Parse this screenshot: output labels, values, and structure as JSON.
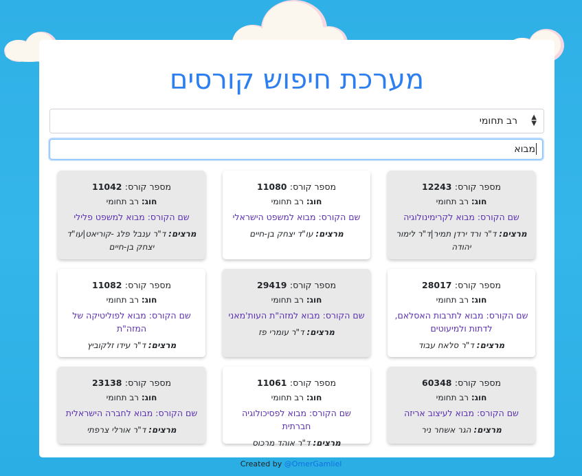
{
  "header": {
    "title": "מערכת חיפוש קורסים"
  },
  "filter": {
    "selected": "רב תחומי"
  },
  "search": {
    "value": "מבוא"
  },
  "labels": {
    "course_number": "מספר קורס:",
    "department": "חוג:",
    "course_name": "שם הקורס:",
    "lecturers": "מרצים:"
  },
  "courses": [
    {
      "number": "12243",
      "department": "רב תחומי",
      "name": "מבוא לקרימינולוגיה",
      "lecturers": "ד\"ר ורד ירדן תמיר|ד\"ר לימור יהודה"
    },
    {
      "number": "11080",
      "department": "רב תחומי",
      "name": "מבוא למשפט הישראלי",
      "lecturers": "עו\"ד יצחק בן-חיים"
    },
    {
      "number": "11042",
      "department": "רב תחומי",
      "name": "מבוא למשפט פלילי",
      "lecturers": "ד\"ר ענבל פלג -קוריאט|עו\"ד יצחק בן-חיים"
    },
    {
      "number": "28017",
      "department": "רב תחומי",
      "name": "מבוא לתרבות האסלאם, לדתות ולמיעוטים",
      "lecturers": "ד\"ר סלאח עבוד"
    },
    {
      "number": "29419",
      "department": "רב תחומי",
      "name": "מבוא למזה\"ת העות'מאני",
      "lecturers": "ד\"ר עומרי פז"
    },
    {
      "number": "11082",
      "department": "רב תחומי",
      "name": "מבוא לפוליטיקה של המזה\"ת",
      "lecturers": "ד\"ר עידו זלקוביץ"
    },
    {
      "number": "60348",
      "department": "רב תחומי",
      "name": "מבוא לעיצוב אריזה",
      "lecturers": "הגר אשחר ניר"
    },
    {
      "number": "11061",
      "department": "רב תחומי",
      "name": "מבוא לפסיכולוגיה חברתית",
      "lecturers": "ד\"ר אוהד מרכוס"
    },
    {
      "number": "23138",
      "department": "רב תחומי",
      "name": "מבוא לחברה הישראלית",
      "lecturers": "ד\"ר אורלי צרפתי"
    }
  ],
  "footer": {
    "text": "Created by",
    "link": "@OmerGamliel"
  },
  "colors": {
    "accent": "#2d7ff0",
    "course_name": "#5a2fb0",
    "background": "#35b6ea"
  }
}
